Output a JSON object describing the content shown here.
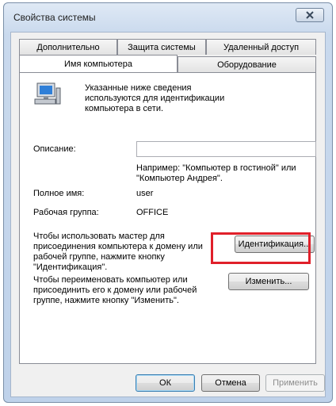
{
  "window": {
    "title": "Свойства системы"
  },
  "tabs_top": [
    {
      "label": "Дополнительно"
    },
    {
      "label": "Защита системы"
    },
    {
      "label": "Удаленный доступ"
    }
  ],
  "tabs_bottom": [
    {
      "label": "Имя компьютера",
      "active": true
    },
    {
      "label": "Оборудование",
      "active": false
    }
  ],
  "computer_name": {
    "intro": "Указанные ниже сведения используются для идентификации компьютера в сети.",
    "description_label": "Описание:",
    "description_value": "",
    "example": "Например: \"Компьютер в гостиной\" или \"Компьютер Андрея\".",
    "full_name_label": "Полное имя:",
    "full_name_value": "user",
    "workgroup_label": "Рабочая группа:",
    "workgroup_value": "OFFICE",
    "network_id_text": "Чтобы использовать мастер для присоединения компьютера к домену или рабочей группе, нажмите кнопку \"Идентификация\".",
    "network_id_button": "Идентификация...",
    "rename_text": "Чтобы переименовать компьютер или присоединить его к домену или рабочей группе, нажмите кнопку \"Изменить\".",
    "change_button": "Изменить..."
  },
  "footer": {
    "ok": "ОК",
    "cancel": "Отмена",
    "apply": "Применить"
  },
  "icons": {
    "close": "close-icon",
    "computer": "computer-icon"
  },
  "colors": {
    "highlight": "#e0202a",
    "titlebar": "#c9d9ed"
  }
}
